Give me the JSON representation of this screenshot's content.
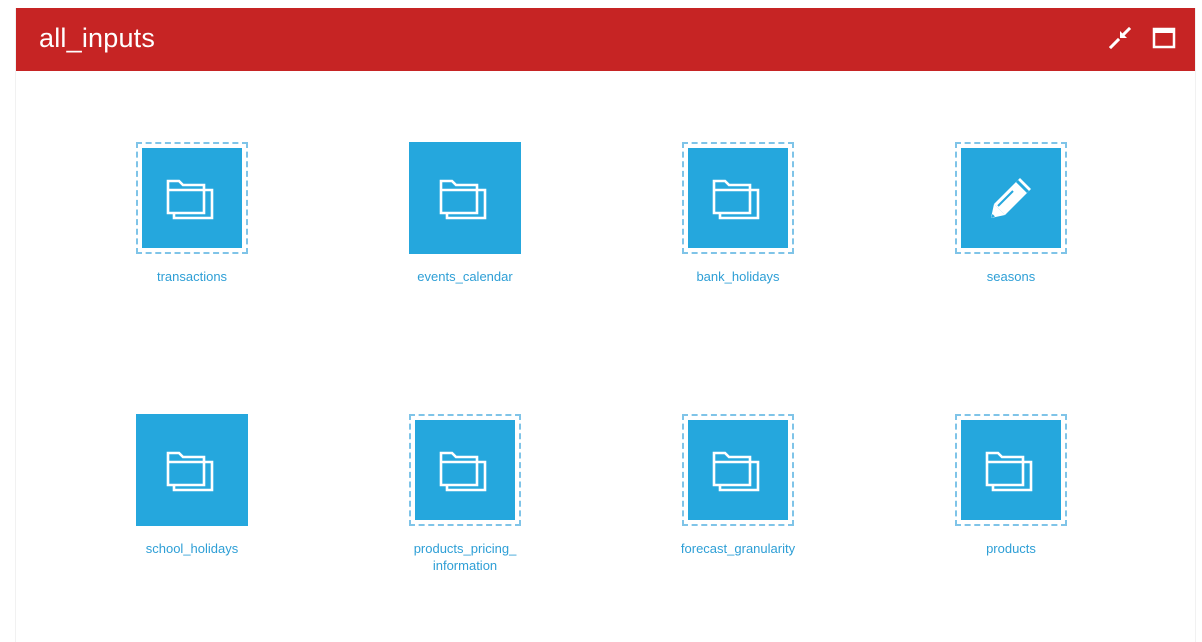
{
  "window": {
    "title": "all_inputs",
    "collapse_icon": "collapse-arrows-icon",
    "maximize_icon": "maximize-window-icon"
  },
  "colors": {
    "header": "#c62424",
    "tile": "#25a7dd",
    "label": "#2e9fd6",
    "selection_border": "#7fc4e8"
  },
  "items": [
    {
      "label": "transactions",
      "icon": "folder-icon",
      "selected": true
    },
    {
      "label": "events_calendar",
      "icon": "folder-icon",
      "selected": false
    },
    {
      "label": "bank_holidays",
      "icon": "folder-icon",
      "selected": true
    },
    {
      "label": "seasons",
      "icon": "pencil-icon",
      "selected": true
    },
    {
      "label": "school_holidays",
      "icon": "folder-icon",
      "selected": false
    },
    {
      "label": "products_pricing_\ninformation",
      "icon": "folder-icon",
      "selected": true
    },
    {
      "label": "forecast_granularity",
      "icon": "folder-icon",
      "selected": true
    },
    {
      "label": "products",
      "icon": "folder-icon",
      "selected": true
    }
  ]
}
